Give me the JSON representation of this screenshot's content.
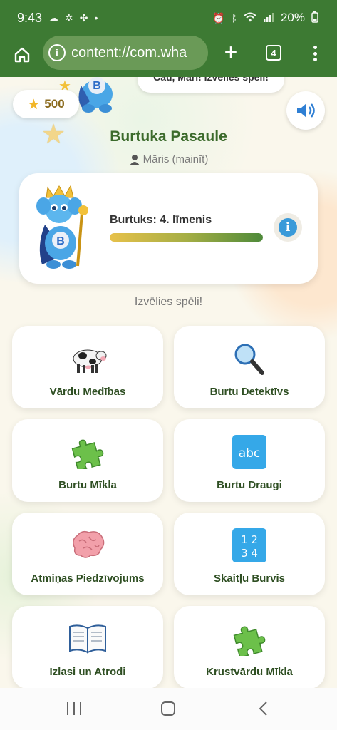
{
  "status_bar": {
    "time": "9:43",
    "battery": "20%"
  },
  "browser": {
    "url": "content://com.wha",
    "tab_count": "4"
  },
  "header": {
    "score": "500",
    "speech": "Čau, Māri! Izvēlies spēli!",
    "title": "Burtuka Pasaule",
    "user": "Māris (mainīt)"
  },
  "level": {
    "label": "Burtuks: 4. līmenis",
    "progress": 1.0
  },
  "choose_text": "Izvēlies spēli!",
  "games": [
    {
      "name": "Vārdu Medības",
      "icon": "cow-icon"
    },
    {
      "name": "Burtu Detektīvs",
      "icon": "magnifier-icon"
    },
    {
      "name": "Burtu Mīkla",
      "icon": "puzzle-icon"
    },
    {
      "name": "Burtu Draugi",
      "icon": "abc-icon",
      "icon_text": "abc"
    },
    {
      "name": "Atmiņas Piedzīvojums",
      "icon": "brain-icon"
    },
    {
      "name": "Skaitļu Burvis",
      "icon": "numbers-icon",
      "icon_text": "1 2 3 4"
    },
    {
      "name": "Izlasi un Atrodi",
      "icon": "book-icon"
    },
    {
      "name": "Krustvārdu Mīkla",
      "icon": "puzzle-icon"
    }
  ],
  "colors": {
    "brand_green": "#3d7a33",
    "title_green": "#3b6a2b",
    "star_gold": "#f2b72a",
    "info_blue": "#3a9ad9"
  }
}
